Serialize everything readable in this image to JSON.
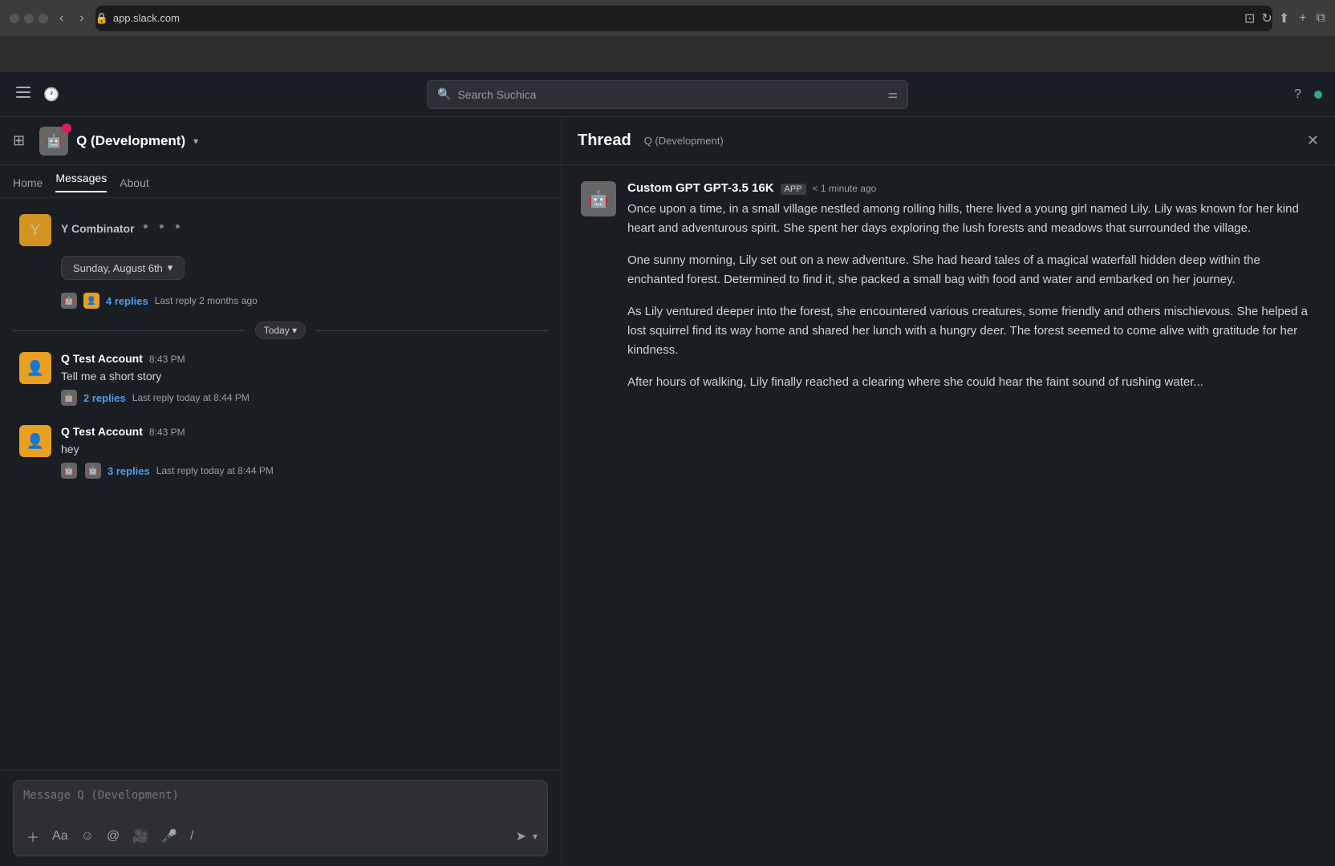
{
  "browser": {
    "url": "app.slack.com",
    "lock_icon": "🔒"
  },
  "search": {
    "placeholder": "Search Suchica"
  },
  "channel": {
    "name": "Q (Development)",
    "tabs": [
      {
        "label": "Home",
        "active": false
      },
      {
        "label": "Messages",
        "active": true
      },
      {
        "label": "About",
        "active": false
      }
    ]
  },
  "date_sections": {
    "sunday_label": "Sunday, August 6th",
    "today_label": "Today"
  },
  "messages": [
    {
      "id": "ycombinator",
      "author": "Y Combinator",
      "text_preview": "Y Combinator...",
      "reply_count": "4 replies",
      "reply_last": "Last reply 2 months ago",
      "time": ""
    },
    {
      "id": "msg1",
      "author": "Q Test Account",
      "time": "8:43 PM",
      "text": "Tell me a short story",
      "reply_count": "2 replies",
      "reply_last": "Last reply today at 8:44 PM"
    },
    {
      "id": "msg2",
      "author": "Q Test Account",
      "time": "8:43 PM",
      "text": "hey",
      "reply_count": "3 replies",
      "reply_last": "Last reply today at 8:44 PM"
    }
  ],
  "message_input": {
    "placeholder": "Message Q (Development)"
  },
  "thread": {
    "title": "Thread",
    "channel": "Q (Development)",
    "message": {
      "author": "Custom GPT GPT-3.5 16K",
      "time": "< 1 minute ago",
      "app_badge": "APP",
      "paragraphs": [
        "Once upon a time, in a small village nestled among rolling hills, there lived a young girl named Lily. Lily was known for her kind heart and adventurous spirit. She spent her days exploring the lush forests and meadows that surrounded the village.",
        "One sunny morning, Lily set out on a new adventure. She had heard tales of a magical waterfall hidden deep within the enchanted forest. Determined to find it, she packed a small bag with food and water and embarked on her journey.",
        "As Lily ventured deeper into the forest, she encountered various creatures, some friendly and others mischievous. She helped a lost squirrel find its way home and shared her lunch with a hungry deer. The forest seemed to come alive with gratitude for her kindness.",
        "After hours of walking, Lily finally reached a clearing where she could hear the faint sound of rushing water..."
      ]
    }
  }
}
